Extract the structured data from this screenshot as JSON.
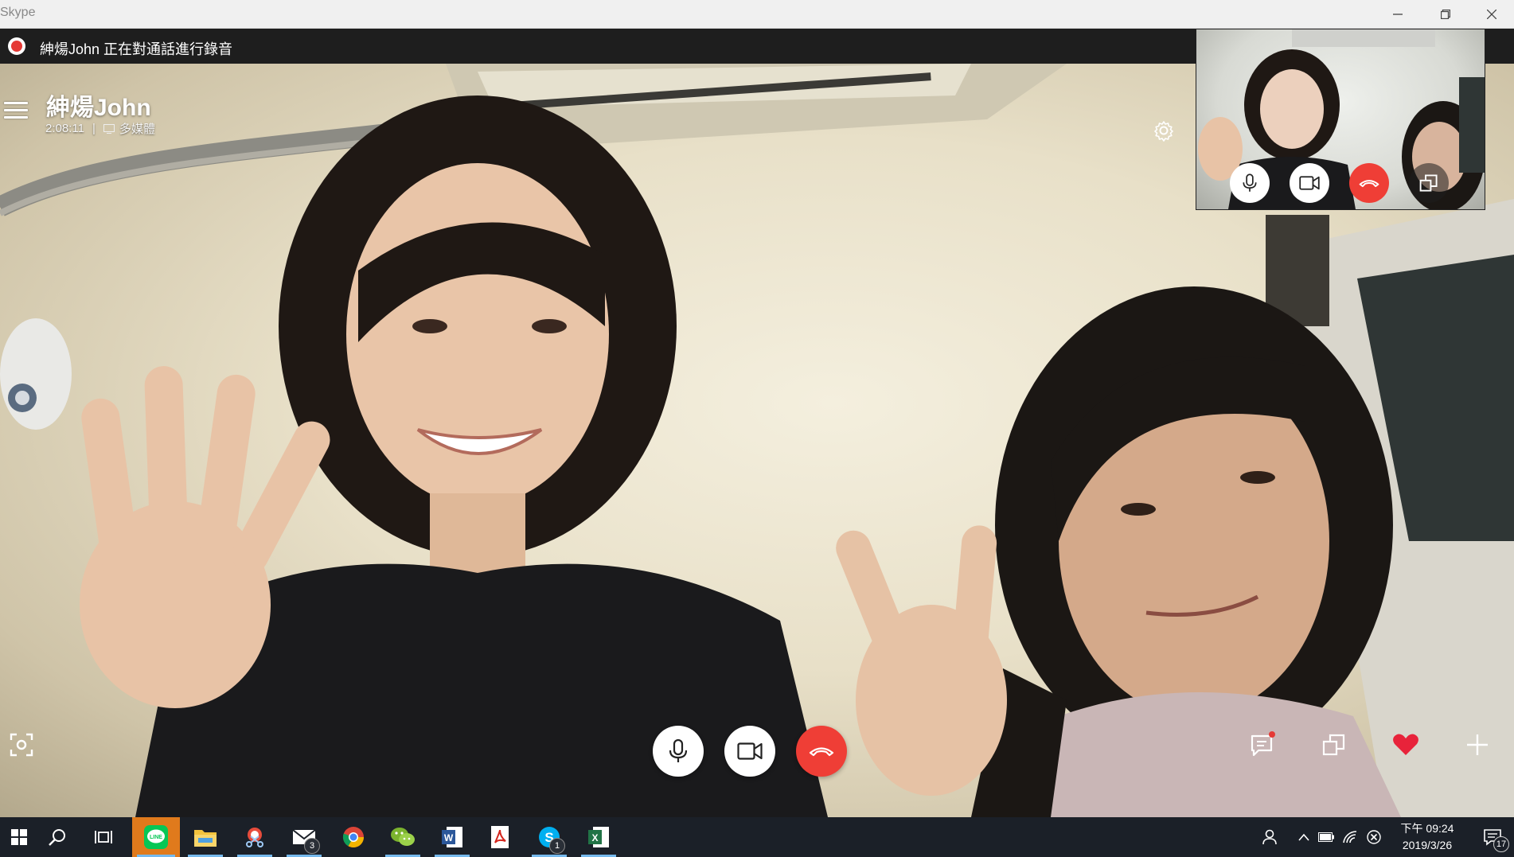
{
  "window": {
    "title": "Skype",
    "minimize_label": "",
    "restore_label": "",
    "close_label": ""
  },
  "recording": {
    "text": "紳煬John 正在對通話進行錄音"
  },
  "call": {
    "contact_name": "紳煬John",
    "duration": "2:08:11",
    "separator": "|",
    "mode_label": "多媒體"
  },
  "self_view": {
    "controls": [
      "microphone-icon",
      "video-camera-icon",
      "end-call-icon",
      "switch-window-icon"
    ]
  },
  "controls": {
    "main": [
      "microphone-icon",
      "video-camera-icon",
      "end-call-icon"
    ],
    "left": [
      "snapshot-icon"
    ],
    "right": [
      "chat-icon",
      "switch-window-icon",
      "heart-icon",
      "add-icon"
    ],
    "accent_red": "#ef3e36",
    "heart_color": "#e8233a",
    "chat_notification_color": "#e53935"
  },
  "taskbar": {
    "apps": [
      {
        "name": "line",
        "active": true
      },
      {
        "name": "file-explorer",
        "active": false
      },
      {
        "name": "snipping-tool",
        "active": false
      },
      {
        "name": "mail",
        "badge": "3",
        "active": false
      },
      {
        "name": "chrome",
        "active": false
      },
      {
        "name": "wechat",
        "active": false
      },
      {
        "name": "word",
        "active": false
      },
      {
        "name": "acrobat",
        "active": false
      },
      {
        "name": "skype",
        "badge": "1",
        "active": false
      },
      {
        "name": "excel",
        "active": false
      }
    ],
    "tray": {
      "clock_time": "下午 09:24",
      "clock_date": "2019/3/26",
      "notification_count": "17"
    }
  }
}
